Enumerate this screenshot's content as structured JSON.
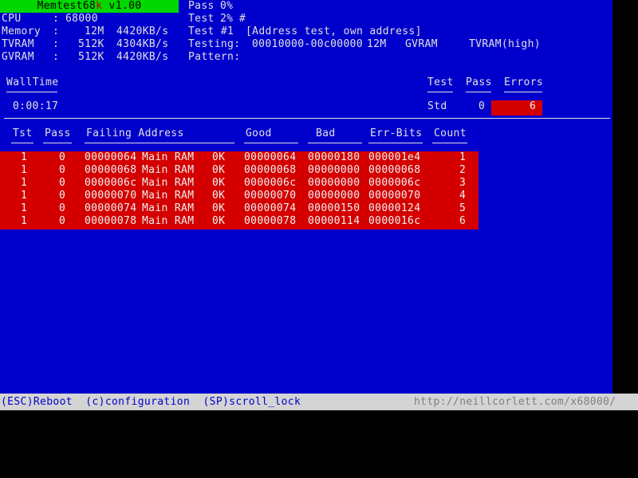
{
  "app": {
    "title_prefix": "Memtest68",
    "title_hot_key": "k",
    "title_suffix": " v1.00"
  },
  "system_info": {
    "rows": [
      {
        "label": "CPU",
        "sep": ":",
        "value": "68000",
        "rate": ""
      },
      {
        "label": "Memory",
        "sep": ":",
        "value": "12M",
        "rate": "4420KB/s"
      },
      {
        "label": "TVRAM",
        "sep": ":",
        "value": "512K",
        "rate": "4304KB/s"
      },
      {
        "label": "GVRAM",
        "sep": ":",
        "value": "512K",
        "rate": "4420KB/s"
      }
    ]
  },
  "progress": {
    "pass_label": "Pass",
    "pass_percent": "0%",
    "test_label": "Test",
    "test_percent": "2%",
    "test_bar": "#",
    "test_number_label": "Test #1",
    "test_description": "[Address test, own address]",
    "testing_label": "Testing:",
    "testing_range": "00010000-00c00000",
    "testing_size": "12M",
    "testing_region_1": "GVRAM",
    "testing_region_2": "TVRAM(high)",
    "pattern_label": "Pattern:",
    "pattern_value": ""
  },
  "walltime": {
    "header": "WallTime",
    "value": "0:00:17"
  },
  "summary": {
    "headers": [
      "Test",
      "Pass",
      "Errors"
    ],
    "test_value": "Std",
    "pass_value": "0",
    "errors_value": "6",
    "errors_highlight_color": "#d40000"
  },
  "error_table": {
    "columns": [
      "Tst",
      "Pass",
      "Failing Address",
      "Good",
      "Bad",
      "Err-Bits",
      "Count"
    ],
    "rows": [
      {
        "tst": "1",
        "pass": "0",
        "addr": "00000064",
        "region": "Main RAM",
        "offset": "0K",
        "good": "00000064",
        "bad": "00000180",
        "errbits": "000001e4",
        "count": "1"
      },
      {
        "tst": "1",
        "pass": "0",
        "addr": "00000068",
        "region": "Main RAM",
        "offset": "0K",
        "good": "00000068",
        "bad": "00000000",
        "errbits": "00000068",
        "count": "2"
      },
      {
        "tst": "1",
        "pass": "0",
        "addr": "0000006c",
        "region": "Main RAM",
        "offset": "0K",
        "good": "0000006c",
        "bad": "00000000",
        "errbits": "0000006c",
        "count": "3"
      },
      {
        "tst": "1",
        "pass": "0",
        "addr": "00000070",
        "region": "Main RAM",
        "offset": "0K",
        "good": "00000070",
        "bad": "00000000",
        "errbits": "00000070",
        "count": "4"
      },
      {
        "tst": "1",
        "pass": "0",
        "addr": "00000074",
        "region": "Main RAM",
        "offset": "0K",
        "good": "00000074",
        "bad": "00000150",
        "errbits": "00000124",
        "count": "5"
      },
      {
        "tst": "1",
        "pass": "0",
        "addr": "00000078",
        "region": "Main RAM",
        "offset": "0K",
        "good": "00000078",
        "bad": "00000114",
        "errbits": "0000016c",
        "count": "6"
      }
    ]
  },
  "statusbar": {
    "keys": "(ESC)Reboot  (c)configuration  (SP)scroll_lock",
    "url": "http://neillcorlett.com/x68000/"
  },
  "colors": {
    "background": "#0000cc",
    "title_bar": "#00d800",
    "error_red": "#d40000",
    "text": "#e0e0e0",
    "statusbar_bg": "#d4d4d4",
    "statusbar_text": "#0000cc",
    "url_text": "#808080",
    "outside": "#000000"
  }
}
